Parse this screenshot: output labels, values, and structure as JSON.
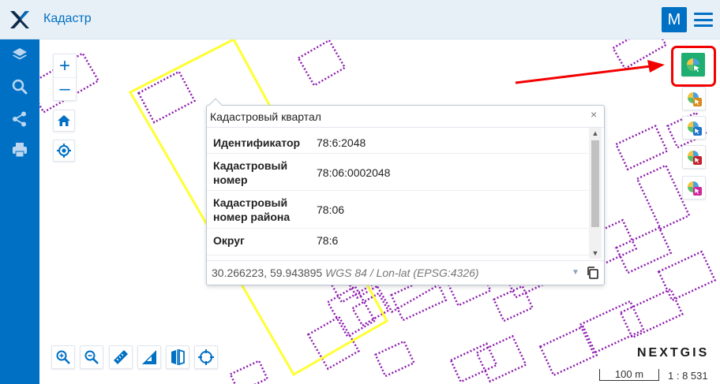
{
  "header": {
    "app_title": "Кадастр",
    "user_initial": "M"
  },
  "sidebar": {
    "items": [
      {
        "icon": "layers-icon"
      },
      {
        "icon": "search-icon"
      },
      {
        "icon": "share-icon"
      },
      {
        "icon": "print-icon"
      }
    ]
  },
  "map_controls": {
    "zoom_in": "+",
    "zoom_out": "–"
  },
  "popup": {
    "title": "Кадастровый квартал",
    "close": "×",
    "properties": [
      {
        "key": "Идентификатор",
        "value": "78:6:2048"
      },
      {
        "key": "Кадастровый номер",
        "value": "78:06:0002048"
      },
      {
        "key": "Кадастровый номер района",
        "value": "78:06"
      },
      {
        "key": "Округ",
        "value": "78:6"
      }
    ],
    "coords": "30.266223, 59.943895",
    "crs": "WGS 84 / Lon-lat (EPSG:4326)"
  },
  "footer": {
    "brand": "NEXTGIS",
    "scale_label": "100 m",
    "scale_text": "1 : 8 531"
  },
  "colors": {
    "accent": "#0070c5",
    "parcel": "#8e1bb0",
    "selected_outline": "#ffff33",
    "annotation_red": "#f20000",
    "active_tool": "#1fae72"
  }
}
